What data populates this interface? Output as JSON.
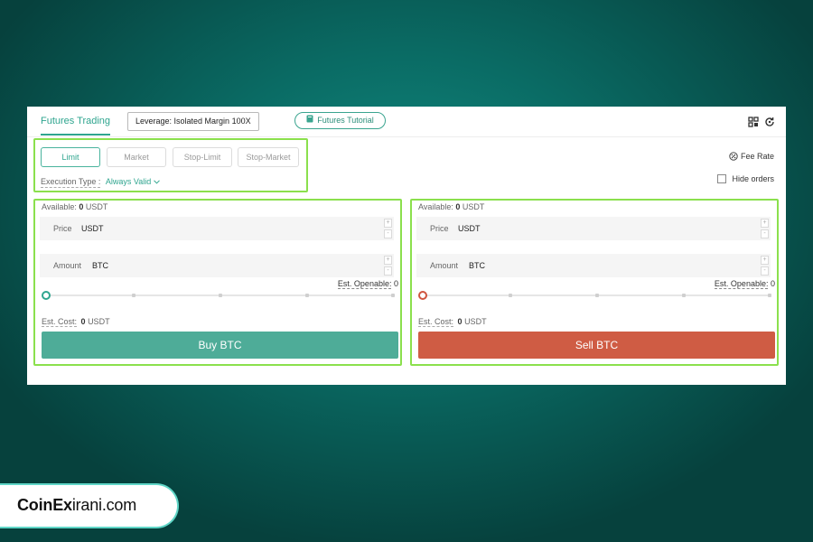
{
  "header": {
    "tab_label": "Futures Trading",
    "leverage_label": "Leverage: Isolated Margin 100X",
    "tutorial_label": "Futures Tutorial",
    "icons": [
      "layout-grid-icon",
      "refresh-icon"
    ]
  },
  "order_types": {
    "tabs": [
      "Limit",
      "Market",
      "Stop-Limit",
      "Stop-Market"
    ],
    "active": "Limit",
    "execution_label": "Execution Type :",
    "execution_value": "Always Valid"
  },
  "right_controls": {
    "fee_rate": "Fee Rate",
    "hide_orders": "Hide orders"
  },
  "buy": {
    "available_label": "Available:",
    "available_value": "0",
    "available_unit": "USDT",
    "price_label": "Price",
    "price_unit": "USDT",
    "amount_label": "Amount",
    "amount_unit": "BTC",
    "est_openable_label": "Est. Openable:",
    "est_openable_value": "0",
    "est_cost_label": "Est. Cost:",
    "est_cost_value": "0",
    "est_cost_unit": "USDT",
    "button_label": "Buy BTC",
    "slider_percent": 0
  },
  "sell": {
    "available_label": "Available:",
    "available_value": "0",
    "available_unit": "USDT",
    "price_label": "Price",
    "price_unit": "USDT",
    "amount_label": "Amount",
    "amount_unit": "BTC",
    "est_openable_label": "Est. Openable:",
    "est_openable_value": "0",
    "est_cost_label": "Est. Cost:",
    "est_cost_value": "0",
    "est_cost_unit": "USDT",
    "button_label": "Sell BTC",
    "slider_percent": 0
  },
  "stepper": {
    "plus": "+",
    "minus": "-"
  },
  "brand": {
    "part1": "CoinEx",
    "part2": "irani.com"
  },
  "colors": {
    "accent": "#2fa58f",
    "buy": "#4eac98",
    "sell": "#cf5c44",
    "highlight": "#8be04d"
  }
}
